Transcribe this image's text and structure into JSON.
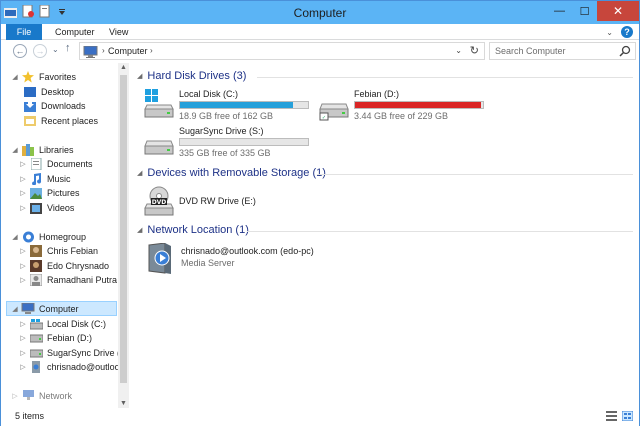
{
  "window": {
    "title": "Computer",
    "controls": {
      "minimize": "—",
      "maximize": "☐",
      "close": "✕"
    }
  },
  "ribbon": {
    "tabs": [
      "File",
      "Computer",
      "View"
    ],
    "help": "?"
  },
  "address_bar": {
    "path": "Computer",
    "search_placeholder": "Search Computer"
  },
  "nav_pane": {
    "favorites": {
      "label": "Favorites",
      "items": [
        "Desktop",
        "Downloads",
        "Recent places"
      ]
    },
    "libraries": {
      "label": "Libraries",
      "items": [
        "Documents",
        "Music",
        "Pictures",
        "Videos"
      ]
    },
    "homegroup": {
      "label": "Homegroup",
      "items": [
        "Chris Febian",
        "Edo Chrysnado",
        "Ramadhani Putra"
      ]
    },
    "computer": {
      "label": "Computer",
      "items": [
        "Local Disk (C:)",
        "Febian (D:)",
        "SugarSync Drive (S:)",
        "chrisnado@outlook.c"
      ]
    },
    "network": {
      "label": "Network"
    }
  },
  "content": {
    "hard_disk_group": "Hard Disk Drives (3)",
    "drives": [
      {
        "name": "Local Disk (C:)",
        "free_text": "18.9 GB free of 162 GB",
        "used_fraction": 0.88,
        "bar_color": "#26a0da"
      },
      {
        "name": "Febian (D:)",
        "free_text": "3.44 GB free of 229 GB",
        "used_fraction": 0.985,
        "bar_color": "#da2626"
      },
      {
        "name": "SugarSync Drive (S:)",
        "free_text": "335 GB free of 335 GB",
        "used_fraction": 0.0,
        "bar_color": "#26a0da"
      }
    ],
    "removable_group": "Devices with Removable Storage (1)",
    "dvd": {
      "name": "DVD RW Drive (E:)",
      "icon_label": "DVD"
    },
    "network_group": "Network Location (1)",
    "media_server": {
      "name": "chrisnado@outlook.com (edo-pc)",
      "type": "Media Server"
    }
  },
  "status": {
    "items_text": "5 items"
  }
}
